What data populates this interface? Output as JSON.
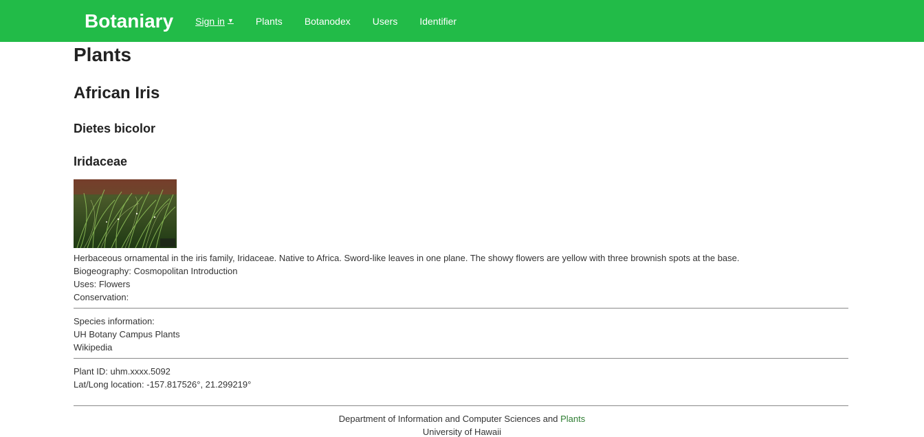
{
  "nav": {
    "brand": "Botaniary",
    "signin": "Sign in",
    "items": [
      "Plants",
      "Botanodex",
      "Users",
      "Identifier"
    ]
  },
  "page": {
    "title": "Plants",
    "common_name": "African Iris",
    "scientific_name": "Dietes bicolor",
    "family": "Iridaceae",
    "description": "Herbaceous ornamental in the iris family, Iridaceae. Native to Africa. Sword-like leaves in one plane. The showy flowers are yellow with three brownish spots at the base.",
    "biogeography": "Biogeography: Cosmopolitan Introduction",
    "uses": "Uses: Flowers",
    "conservation": "Conservation:",
    "species_info_label": "Species information:",
    "links": [
      "UH Botany Campus Plants",
      "Wikipedia"
    ],
    "plant_id": "Plant ID: uhm.xxxx.5092",
    "latlong": "Lat/Long location: -157.817526°, 21.299219°"
  },
  "footer": {
    "dept": "Department of Information and Computer Sciences and ",
    "dept_link": "Plants",
    "univ": "University of Hawaii"
  },
  "colors": {
    "navbar": "#22bb48",
    "link": "#2e7d32"
  }
}
